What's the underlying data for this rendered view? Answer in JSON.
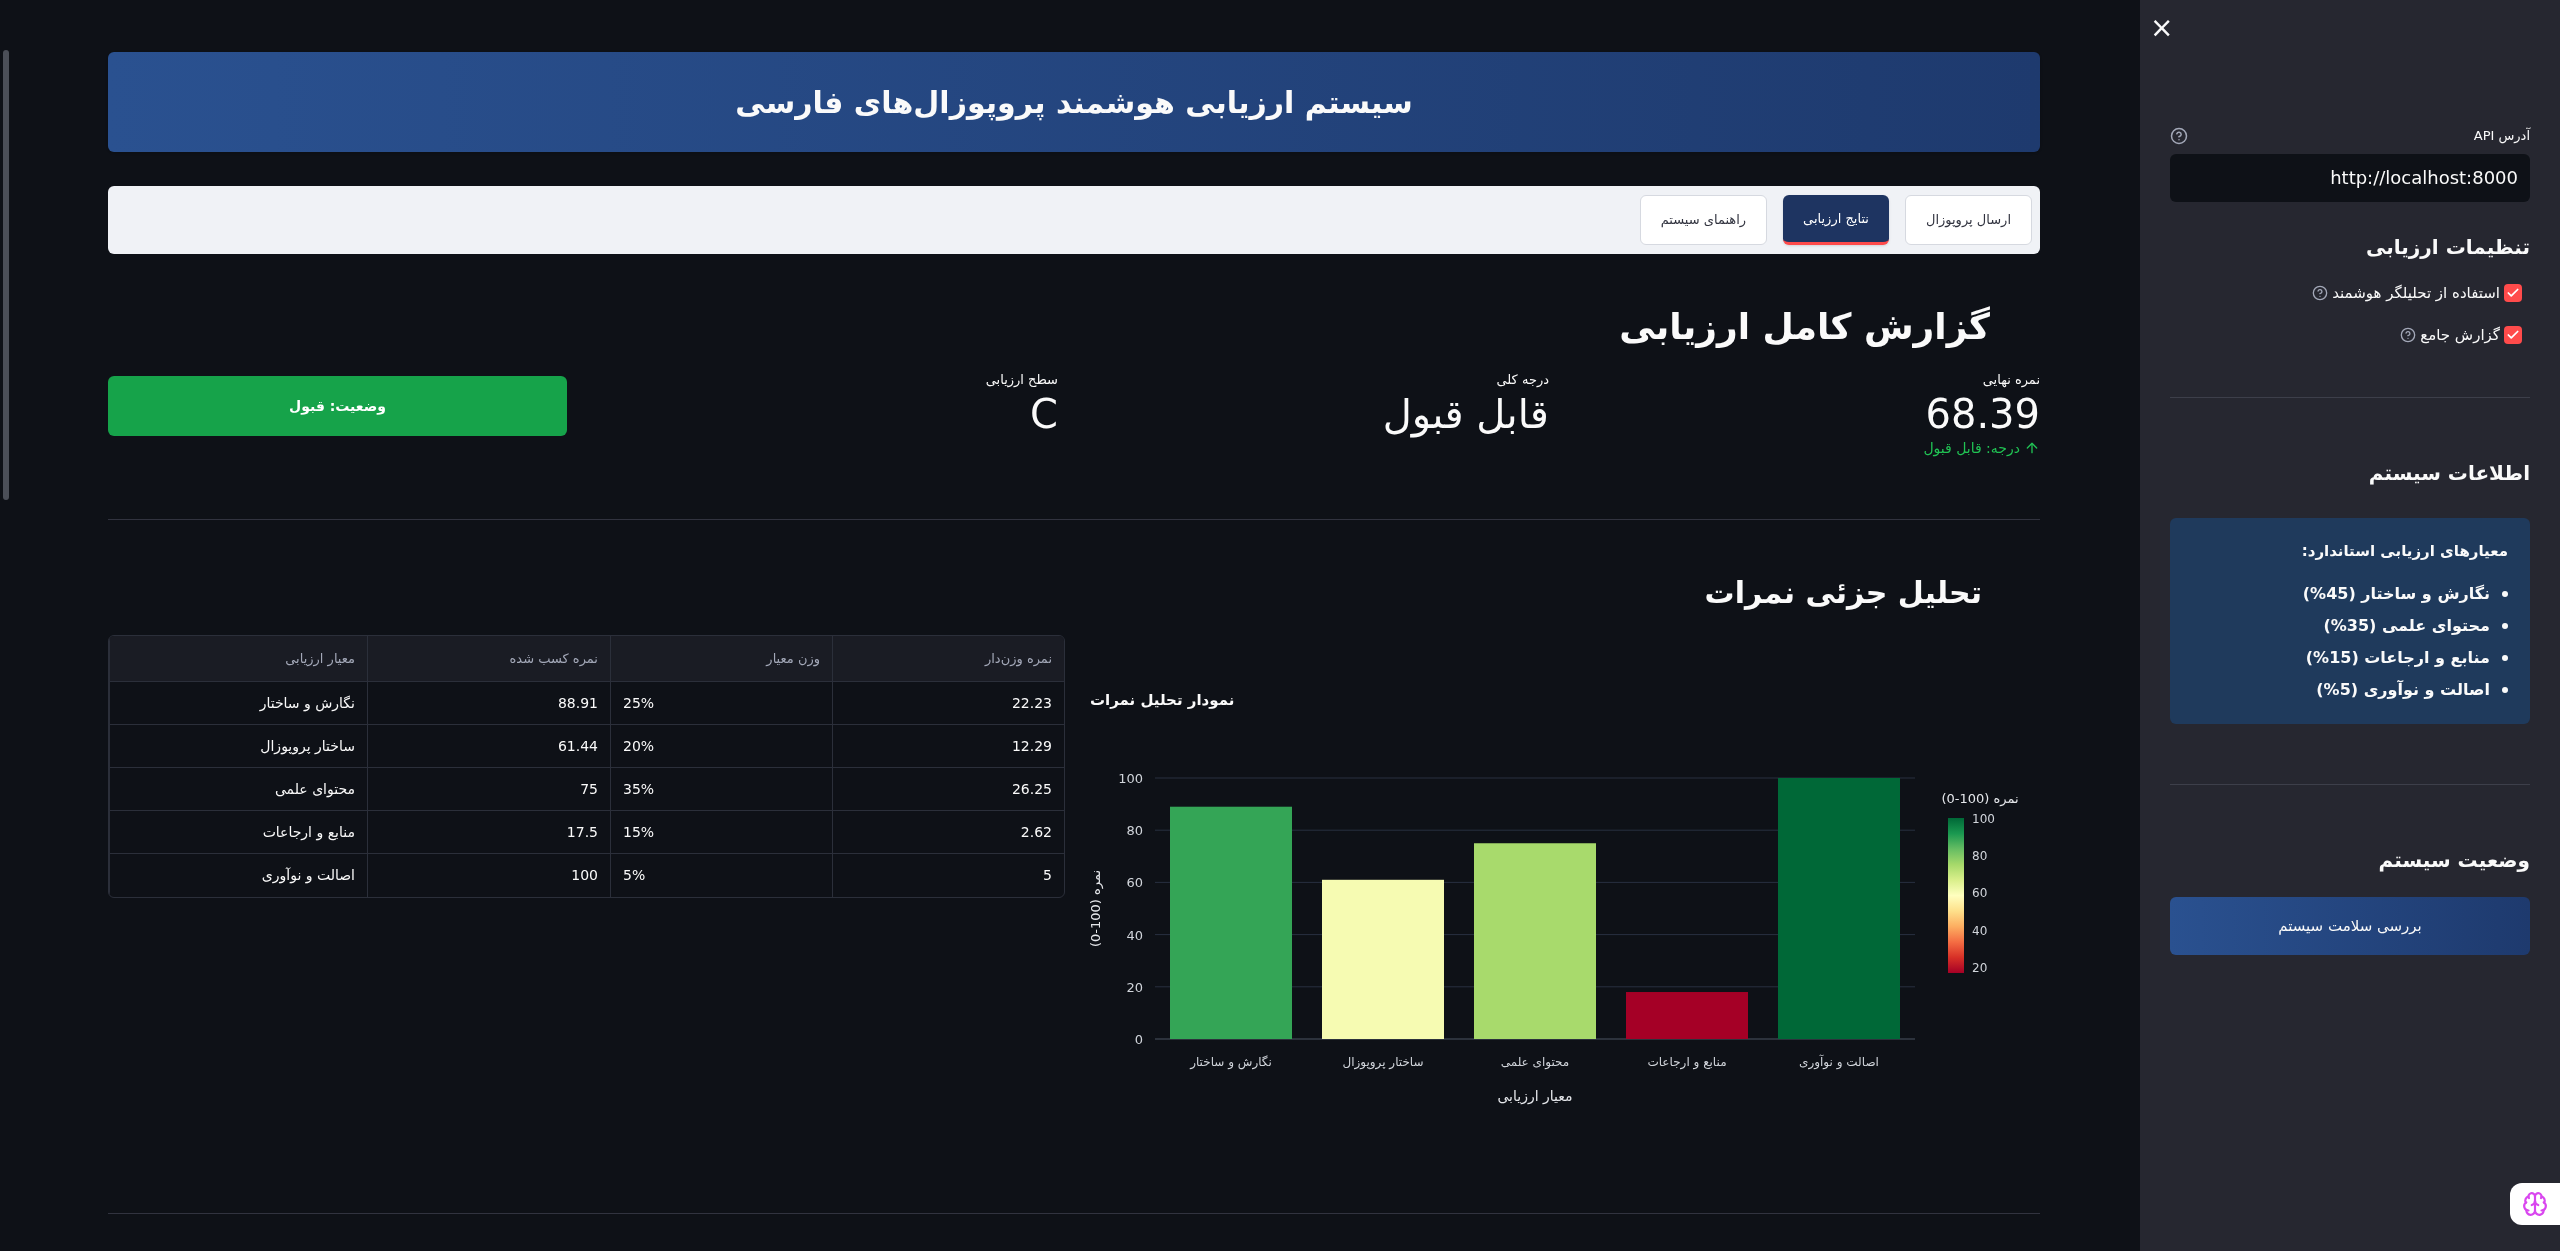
{
  "header": {
    "title": "سیستم ارزیابی هوشمند پروپوزال‌های فارسی"
  },
  "tabs": [
    {
      "label": "ارسال پروپوزال",
      "selected": false
    },
    {
      "label": "نتایج ارزیابی",
      "selected": true
    },
    {
      "label": "راهنمای سیستم",
      "selected": false
    }
  ],
  "report": {
    "title": "گزارش کامل ارزیابی",
    "metrics": [
      {
        "label": "نمره نهایی",
        "value": "68.39",
        "delta": {
          "text": "درجه: قابل قبول"
        }
      },
      {
        "label": "درجه کلی",
        "value": "قابل قبول"
      },
      {
        "label": "سطح ارزیابی",
        "value": "C"
      }
    ],
    "status_button": "وضعیت: قبول"
  },
  "breakdown": {
    "title": "تحلیل جزئی نمرات",
    "table": {
      "columns": [
        "نمره وزن‌دار",
        "وزن معیار",
        "نمره کسب شده",
        "معیار ارزیابی"
      ],
      "rows": [
        [
          "22.23",
          "25%",
          "88.91",
          "نگارش و ساختار"
        ],
        [
          "12.29",
          "20%",
          "61.44",
          "ساختار پروپوزال"
        ],
        [
          "26.25",
          "35%",
          "75",
          "محتوای علمی"
        ],
        [
          "2.62",
          "15%",
          "17.5",
          "منابع و ارجاعات"
        ],
        [
          "5",
          "5%",
          "100",
          "اصالت و نوآوری"
        ]
      ]
    },
    "chart": {
      "chart_data": {
        "type": "bar",
        "title": "نمودار تحلیل نمرات",
        "xlabel": "معیار ارزیابی",
        "ylabel": "نمره (100-0)",
        "categories": [
          "نگارش و ساختار",
          "ساختار پروپوزال",
          "محتوای علمی",
          "منابع و ارجاعات",
          "اصالت و نوآوری"
        ],
        "series": [
          {
            "values": [
              89,
              61,
              75,
              18,
              100
            ]
          }
        ],
        "ylim": [
          0,
          100
        ],
        "yticks": [
          0,
          20,
          40,
          60,
          80,
          100
        ],
        "grid": true
      },
      "colorbar": {
        "title": "نمره (100-0)",
        "ticks": [
          "100",
          "80",
          "60",
          "40",
          "20"
        ]
      }
    }
  },
  "sidebar": {
    "close": "×",
    "api": {
      "label": "آدرس API",
      "value": "http://localhost:8000"
    },
    "settings": {
      "title": "تنظیمات ارزیابی",
      "options": [
        {
          "label": "استفاده از تحلیلگر هوشمند",
          "checked": true
        },
        {
          "label": "گزارش جامع",
          "checked": true
        }
      ]
    },
    "info": {
      "title": "اطلاعات سیستم",
      "box_title": "معیارهای ارزیابی استاندارد:",
      "items": [
        "نگارش و ساختار (45%)",
        "محتوای علمی (35%)",
        "منابع و ارجاعات (15%)",
        "اصالت و نوآوری (5%)"
      ]
    },
    "status": {
      "title": "وضعیت سیستم",
      "button": "بررسی سلامت سیستم"
    }
  }
}
